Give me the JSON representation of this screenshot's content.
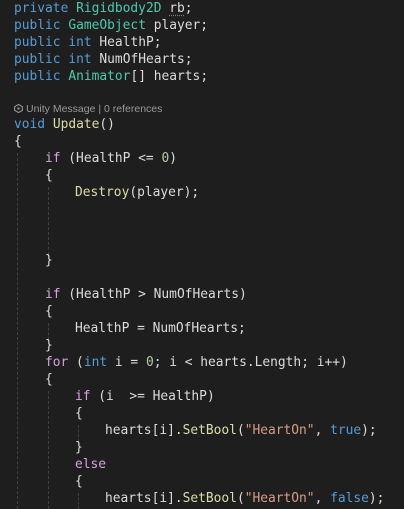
{
  "editor": {
    "theme_colors": {
      "background": "#1e1e1e",
      "keyword": "#569cd6",
      "control": "#d8a0df",
      "type": "#4ec9b0",
      "method": "#dcdcaa",
      "string": "#d69d85",
      "number": "#b5cea8",
      "text": "#dcdcdc"
    },
    "fields": [
      {
        "modifier": "private",
        "type": "Rigidbody2D",
        "name": "rb",
        "end": ";"
      },
      {
        "modifier": "public",
        "type": "GameObject",
        "name": "player",
        "end": ";"
      },
      {
        "modifier": "public",
        "type": "int",
        "name": "HealthP",
        "end": ";"
      },
      {
        "modifier": "public",
        "type": "int",
        "name": "NumOfHearts",
        "end": ";"
      },
      {
        "modifier": "public",
        "type": "Animator",
        "array": "[]",
        "name": "hearts",
        "end": ";"
      }
    ],
    "codelens": {
      "icon": "unity-icon",
      "text": "Unity Message | 0 references"
    },
    "method": {
      "return_type": "void",
      "name": "Update",
      "params": "()"
    },
    "tokens": {
      "if": "if",
      "else": "else",
      "for": "for",
      "int": "int",
      "true": "true",
      "false": "false",
      "destroy": "Destroy",
      "setbool": "SetBool",
      "length": "Length",
      "heart_on": "\"HeartOn\"",
      "zero": "0",
      "open_brace": "{",
      "close_brace": "}"
    },
    "lines": {
      "if1_pre": " (HealthP <= ",
      "if1_post": ")",
      "destroy_args": "(player);",
      "if2_cond": " (HealthP > NumOfHearts)",
      "assign": "HealthP = NumOfHearts;",
      "for_pre": " (",
      "for_mid1": " i = ",
      "for_mid2": "; i < hearts.",
      "for_post": "; i++)",
      "if3_cond": " (i  >= HealthP)",
      "call_pre": "hearts[i].",
      "call_open": "(",
      "call_sep": ", ",
      "call_close": ");"
    }
  }
}
